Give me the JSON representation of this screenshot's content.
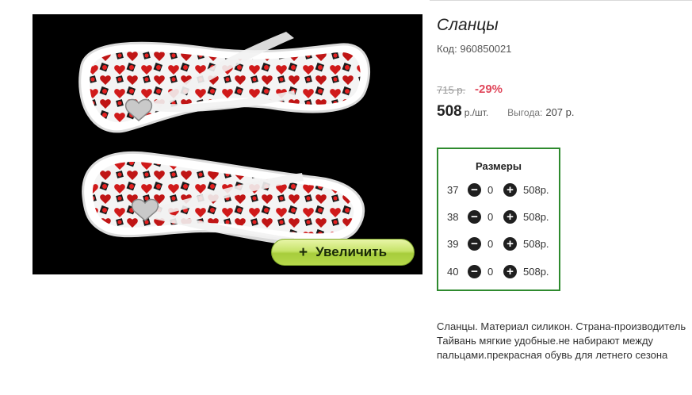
{
  "product": {
    "title": "Сланцы",
    "code_label": "Код:",
    "code_value": "960850021",
    "old_price": "715 р.",
    "discount": "-29%",
    "price": "508",
    "price_unit": "р./шт.",
    "benefit_label": "Выгода:",
    "benefit_value": "207 р.",
    "description": "Сланцы. Материал силикон. Страна-производитель Тайвань мягкие удобные.не набирают между пальцами.прекрасная обувь для летнего сезона"
  },
  "image": {
    "zoom_plus": "+",
    "zoom_label": "Увеличить"
  },
  "sizes": {
    "title": "Размеры",
    "minus_symbol": "−",
    "plus_symbol": "+",
    "rows": [
      {
        "size": "37",
        "qty": "0",
        "price": "508р."
      },
      {
        "size": "38",
        "qty": "0",
        "price": "508р."
      },
      {
        "size": "39",
        "qty": "0",
        "price": "508р."
      },
      {
        "size": "40",
        "qty": "0",
        "price": "508р."
      }
    ]
  },
  "colors": {
    "discount": "#e0475b",
    "sizes_border": "#2e8a2e",
    "zoom_button": "#b6d84a"
  }
}
